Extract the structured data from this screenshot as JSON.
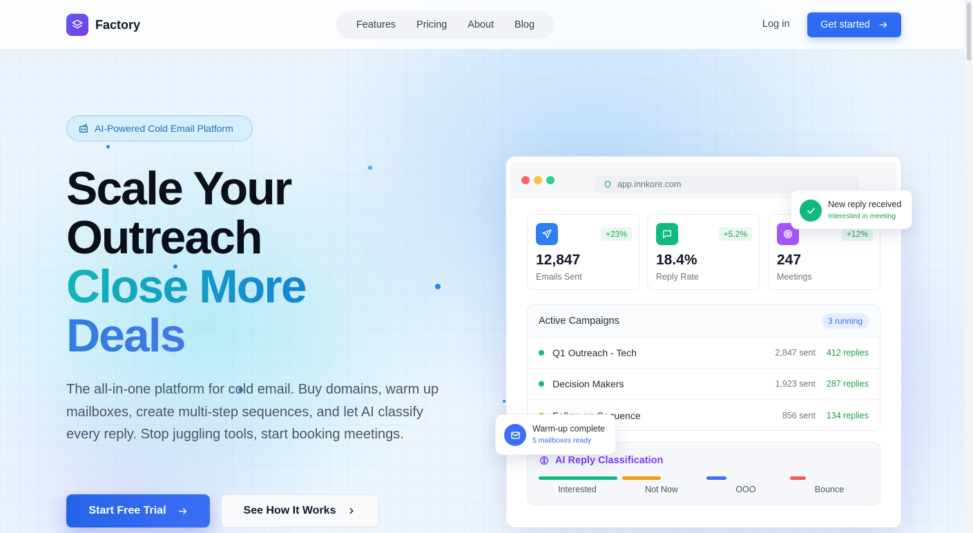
{
  "nav": {
    "brand": "Factory",
    "links": [
      "Features",
      "Pricing",
      "About",
      "Blog"
    ],
    "login": "Log in",
    "cta": "Get started"
  },
  "hero": {
    "badge": "AI-Powered Cold Email Platform",
    "headline": [
      "Scale Your",
      "Outreach",
      "Close More",
      "Deals"
    ],
    "subtext": "The all-in-one platform for cold email. Buy domains, warm up mailboxes, create multi-step sequences, and let AI classify every reply. Stop juggling tools, start booking meetings.",
    "primary_cta": "Start Free Trial",
    "secondary_cta": "See How It Works"
  },
  "dashboard": {
    "url": "app.innkore.com",
    "stats": [
      {
        "value": "12,847",
        "label": "Emails Sent",
        "change": "+23%",
        "icon": "send-icon",
        "color": "#2f7ff0"
      },
      {
        "value": "18.4%",
        "label": "Reply Rate",
        "change": "+5.2%",
        "icon": "chat-icon",
        "color": "#10b981"
      },
      {
        "value": "247",
        "label": "Meetings",
        "change": "+12%",
        "icon": "target-icon",
        "color": "#a855f7"
      }
    ],
    "campaigns": {
      "title": "Active Campaigns",
      "badge": "3 running",
      "rows": [
        {
          "name": "Q1 Outreach - Tech",
          "sent": "2,847 sent",
          "replies": "412 replies",
          "status_color": "#10b981"
        },
        {
          "name": "Decision Makers",
          "sent": "1,923 sent",
          "replies": "287 replies",
          "status_color": "#10b981"
        },
        {
          "name": "Follow-up Sequence",
          "sent": "856 sent",
          "replies": "134 replies",
          "status_color": "#f59e0b"
        }
      ]
    },
    "ai": {
      "title": "AI Reply Classification",
      "categories": [
        {
          "label": "Interested",
          "color": "#10b981"
        },
        {
          "label": "Not Now",
          "color": "#f59e0b"
        },
        {
          "label": "OOO",
          "color": "#3b6ff5"
        },
        {
          "label": "Bounce",
          "color": "#ef5b5b"
        }
      ]
    }
  },
  "toasts": {
    "reply": {
      "title": "New reply received",
      "sub": "Interested in meeting"
    },
    "warmup": {
      "title": "Warm-up complete",
      "sub": "5 mailboxes ready"
    }
  },
  "colors": {
    "accent": "#2f6bf2",
    "brand": "#5b5cf0"
  }
}
